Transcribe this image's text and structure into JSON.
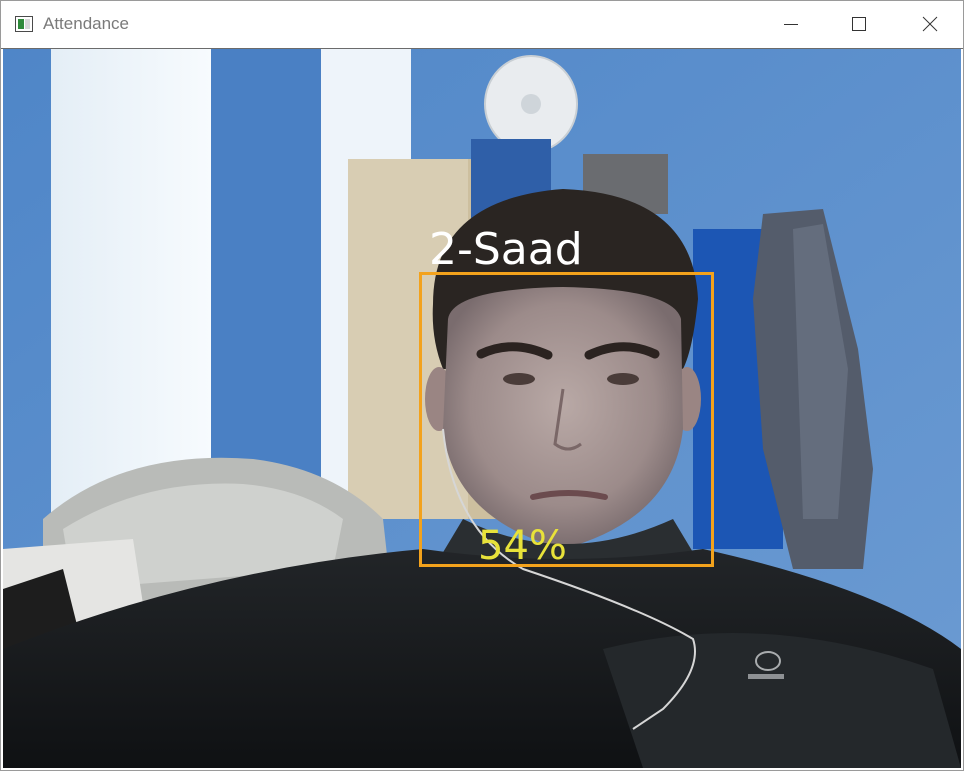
{
  "window": {
    "title": "Attendance",
    "icon": "opencv-window-icon",
    "controls": {
      "minimize": "minimize-icon",
      "maximize": "maximize-icon",
      "close": "close-icon"
    }
  },
  "camera_feed": {
    "detection": {
      "name": "2-Saad",
      "confidence": "54%",
      "box_color": "#f3a21c",
      "name_color": "#ffffff",
      "confidence_color": "#e8e23a"
    }
  }
}
